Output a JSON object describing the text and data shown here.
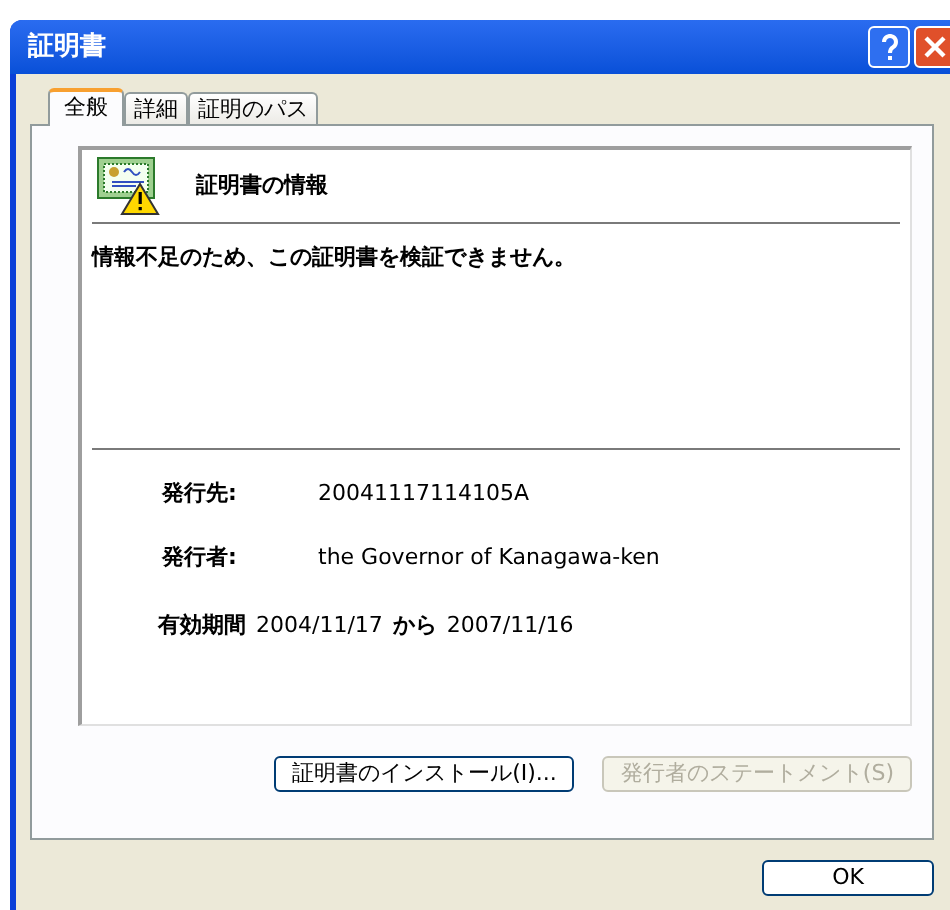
{
  "window": {
    "title": "証明書"
  },
  "tabs": [
    {
      "label": "全般",
      "selected": true
    },
    {
      "label": "詳細",
      "selected": false
    },
    {
      "label": "証明のパス",
      "selected": false
    }
  ],
  "info": {
    "heading": "証明書の情報",
    "message": "情報不足のため、この証明書を検証できません。",
    "fields": [
      {
        "label": "発行先:",
        "value": "20041117114105A"
      },
      {
        "label": "発行者:",
        "value": "the Governor of Kanagawa-ken"
      }
    ],
    "validity": {
      "label": "有効期間",
      "from": "2004/11/17",
      "word": "から",
      "to": "2007/11/16"
    }
  },
  "buttons": [
    {
      "label": "証明書のインストール(I)...",
      "disabled": false
    },
    {
      "label": "発行者のステートメント(S)",
      "disabled": true
    }
  ],
  "ok": "OK"
}
